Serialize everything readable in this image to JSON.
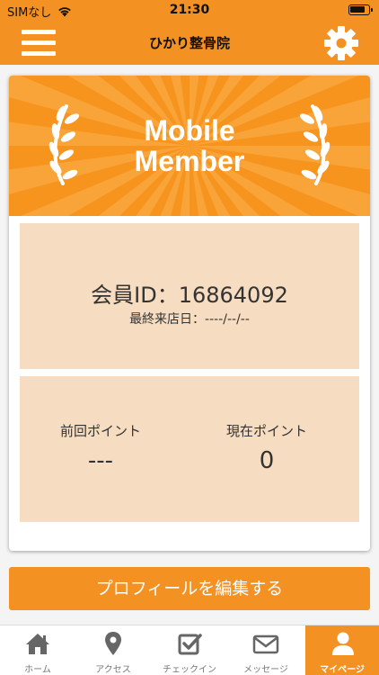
{
  "status_bar": {
    "carrier": "SIMなし",
    "time": "21:30"
  },
  "header": {
    "title": "ひかり整骨院",
    "menu_icon": "hamburger-menu-icon",
    "settings_icon": "gear-icon"
  },
  "banner": {
    "line1": "Mobile",
    "line2": "Member"
  },
  "member": {
    "id_text": "会員ID：16864092",
    "last_visit_text": "最終来店日：----/--/--"
  },
  "points": {
    "previous": {
      "label": "前回ポイント",
      "value": "---"
    },
    "current": {
      "label": "現在ポイント",
      "value": "0"
    }
  },
  "edit_profile_label": "プロフィールを編集する",
  "tabs": [
    {
      "label": "ホーム",
      "icon": "home-icon",
      "active": false
    },
    {
      "label": "アクセス",
      "icon": "map-pin-icon",
      "active": false
    },
    {
      "label": "チェックイン",
      "icon": "checkbox-icon",
      "active": false
    },
    {
      "label": "メッセージ",
      "icon": "mail-icon",
      "active": false
    },
    {
      "label": "マイページ",
      "icon": "user-icon",
      "active": true
    }
  ],
  "colors": {
    "accent": "#f39223",
    "panel": "#f6dcc0",
    "banner_light": "#fbb04e"
  }
}
